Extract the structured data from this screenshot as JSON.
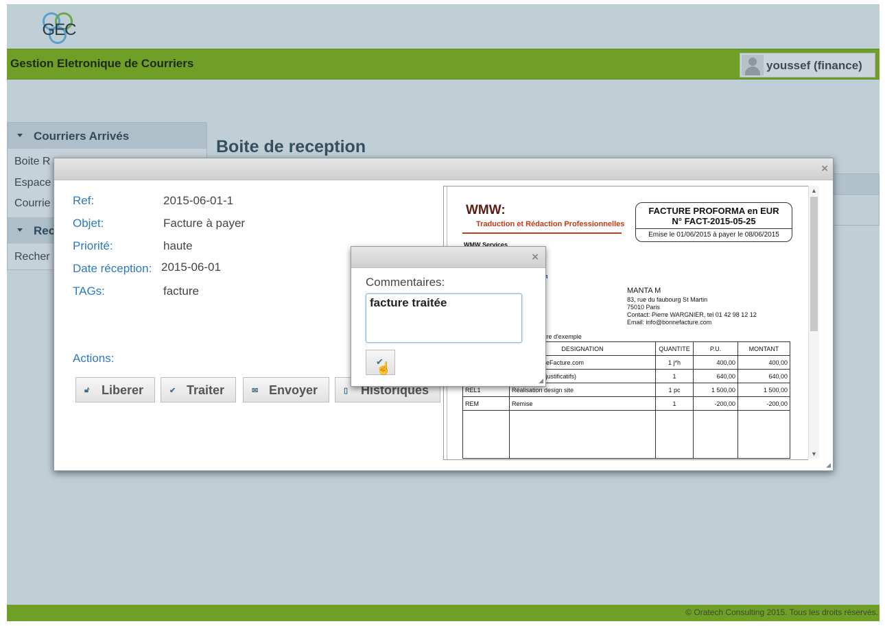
{
  "header": {
    "logo_text": "GEC",
    "app_title": "Gestion Eletronique de Courriers",
    "user_name": "youssef (finance)"
  },
  "sidebar": {
    "section1_title": "Courriers Arrivés",
    "items": [
      "Boite R",
      "Espace",
      "Courrie"
    ],
    "section2_title": "Rec",
    "items2": [
      "Recher"
    ]
  },
  "main": {
    "page_title": "Boite de reception"
  },
  "dialog": {
    "close_glyph": "×",
    "fields": [
      {
        "label": "Ref:",
        "value": "2015-06-01-1"
      },
      {
        "label": "Objet:",
        "value": "Facture à payer"
      },
      {
        "label": "Priorité:",
        "value": "haute"
      },
      {
        "label": "Date réception:",
        "value": "2015-06-01"
      },
      {
        "label": "TAGs:",
        "value": "facture"
      }
    ],
    "actions_label": "Actions:",
    "actions": [
      {
        "label": "Liberer",
        "icon": "unlock-icon"
      },
      {
        "label": "Traiter",
        "icon": "check-icon"
      },
      {
        "label": "Envoyer",
        "icon": "mail-icon"
      },
      {
        "label": "Historiques",
        "icon": "document-icon"
      }
    ]
  },
  "document": {
    "company": "WMW:",
    "company_subtitle": "Traduction et Rédaction Professionnelles",
    "invoice_title": "FACTURE PROFORMA en EUR",
    "invoice_number": "N° FACT-2015-05-25",
    "invoice_dates": "Emise le 01/06/2015 à payer le 08/06/2015",
    "sender_fragment": "WMW Services",
    "blue_fragment": "n",
    "client_name": "MANTA M",
    "client_lines": [
      "83, rue du faubourg St Martin",
      "75010 Paris",
      "Contact: Pierre WARGNIER, tel 01 42 98 12 12",
      "Email: info@bonnefacture.com"
    ],
    "example_fragment": "tre d'exemple",
    "table_headers": [
      "",
      "DESIGNATION",
      "QUANTITE",
      "P.U.",
      "MONTANT"
    ],
    "table_rows": [
      [
        "",
        "gn site BonneFacture.com",
        "1 j*h",
        "400,00",
        "400,00"
      ],
      [
        "",
        "acement (cf justificatifs)",
        "1",
        "640,00",
        "640,00"
      ],
      [
        "REL1",
        "Réalisation design site",
        "1 pc",
        "1 500,00",
        "1 500,00"
      ],
      [
        "REM",
        "Remise",
        "1",
        "-200,00",
        "-200,00"
      ]
    ]
  },
  "comment_dialog": {
    "close_glyph": "×",
    "label": "Commentaires:",
    "value": "facture traitée",
    "ok_icon": "check-icon"
  },
  "footer": {
    "text": "© Oratech Consulting 2015. Tous les droits réservés."
  }
}
